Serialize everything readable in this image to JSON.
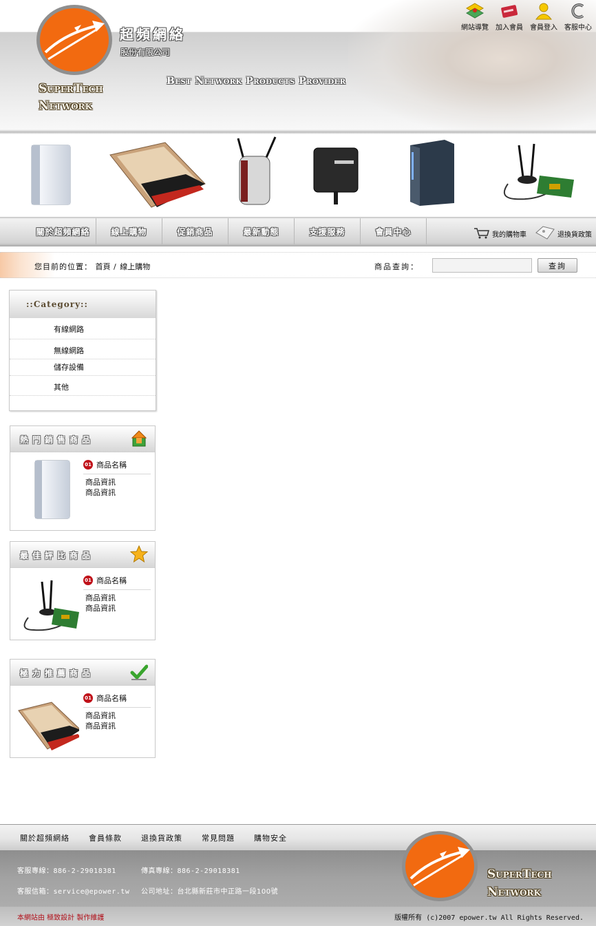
{
  "header": {
    "brand_cn": "超頻網絡",
    "brand_cn_sub": "股份有限公司",
    "brand_en_line1": "SuperTech",
    "brand_en_line2": "Network",
    "tagline": "Best Network Products Provider",
    "toplinks": [
      {
        "label": "網站導覽",
        "icon": "sitemap-icon"
      },
      {
        "label": "加入會員",
        "icon": "member-card-icon"
      },
      {
        "label": "會員登入",
        "icon": "user-login-icon"
      },
      {
        "label": "客服中心",
        "icon": "service-icon"
      }
    ]
  },
  "nav": {
    "items": [
      "關於超頻網絡",
      "線上購物",
      "促銷商品",
      "最新動態",
      "支援服務",
      "會員中心"
    ],
    "cart": "我的購物車",
    "returns": "退換貨政策"
  },
  "breadcrumb": {
    "prefix": "您目前的位置：",
    "home": "首頁",
    "sep": "/",
    "current": "線上購物"
  },
  "search": {
    "label": "商品查詢：",
    "placeholder": "",
    "button": "查詢"
  },
  "category": {
    "title": "::Category::",
    "items": [
      "有線網路",
      "無線網路",
      "儲存設備",
      "其他"
    ]
  },
  "boxes": [
    {
      "title": "熱門銷售商品",
      "icon": "hot-sale-arrow-icon",
      "badge": "01",
      "name": "商品名稱",
      "info1": "商品資訊",
      "info2": "商品資訊"
    },
    {
      "title": "最佳評比商品",
      "icon": "star-icon",
      "badge": "01",
      "name": "商品名稱",
      "info1": "商品資訊",
      "info2": "商品資訊"
    },
    {
      "title": "極力推薦商品",
      "icon": "checkmark-icon",
      "badge": "01",
      "name": "商品名稱",
      "info1": "商品資訊",
      "info2": "商品資訊"
    }
  ],
  "footer": {
    "links": [
      "關於超頻網絡",
      "會員條款",
      "退換貨政策",
      "常見問題",
      "購物安全"
    ],
    "service_phone_label": "客服專線：",
    "service_phone": "886-2-29018381",
    "fax_label": "傳真專線：",
    "fax": "886-2-29018381",
    "email_label": "客服信箱：",
    "email": "service@epower.tw",
    "address_label": "公司地址：",
    "address": "台北縣新莊市中正路一段100號",
    "credit": "本網站由 極致設計 製作維護",
    "copyright": "版權所有 (c)2007 epower.tw All Rights Reserved.",
    "brand_en_line1": "SuperTech",
    "brand_en_line2": "Network"
  },
  "colors": {
    "logo_orange": "#f26a10",
    "accent_red": "#c0121a"
  }
}
